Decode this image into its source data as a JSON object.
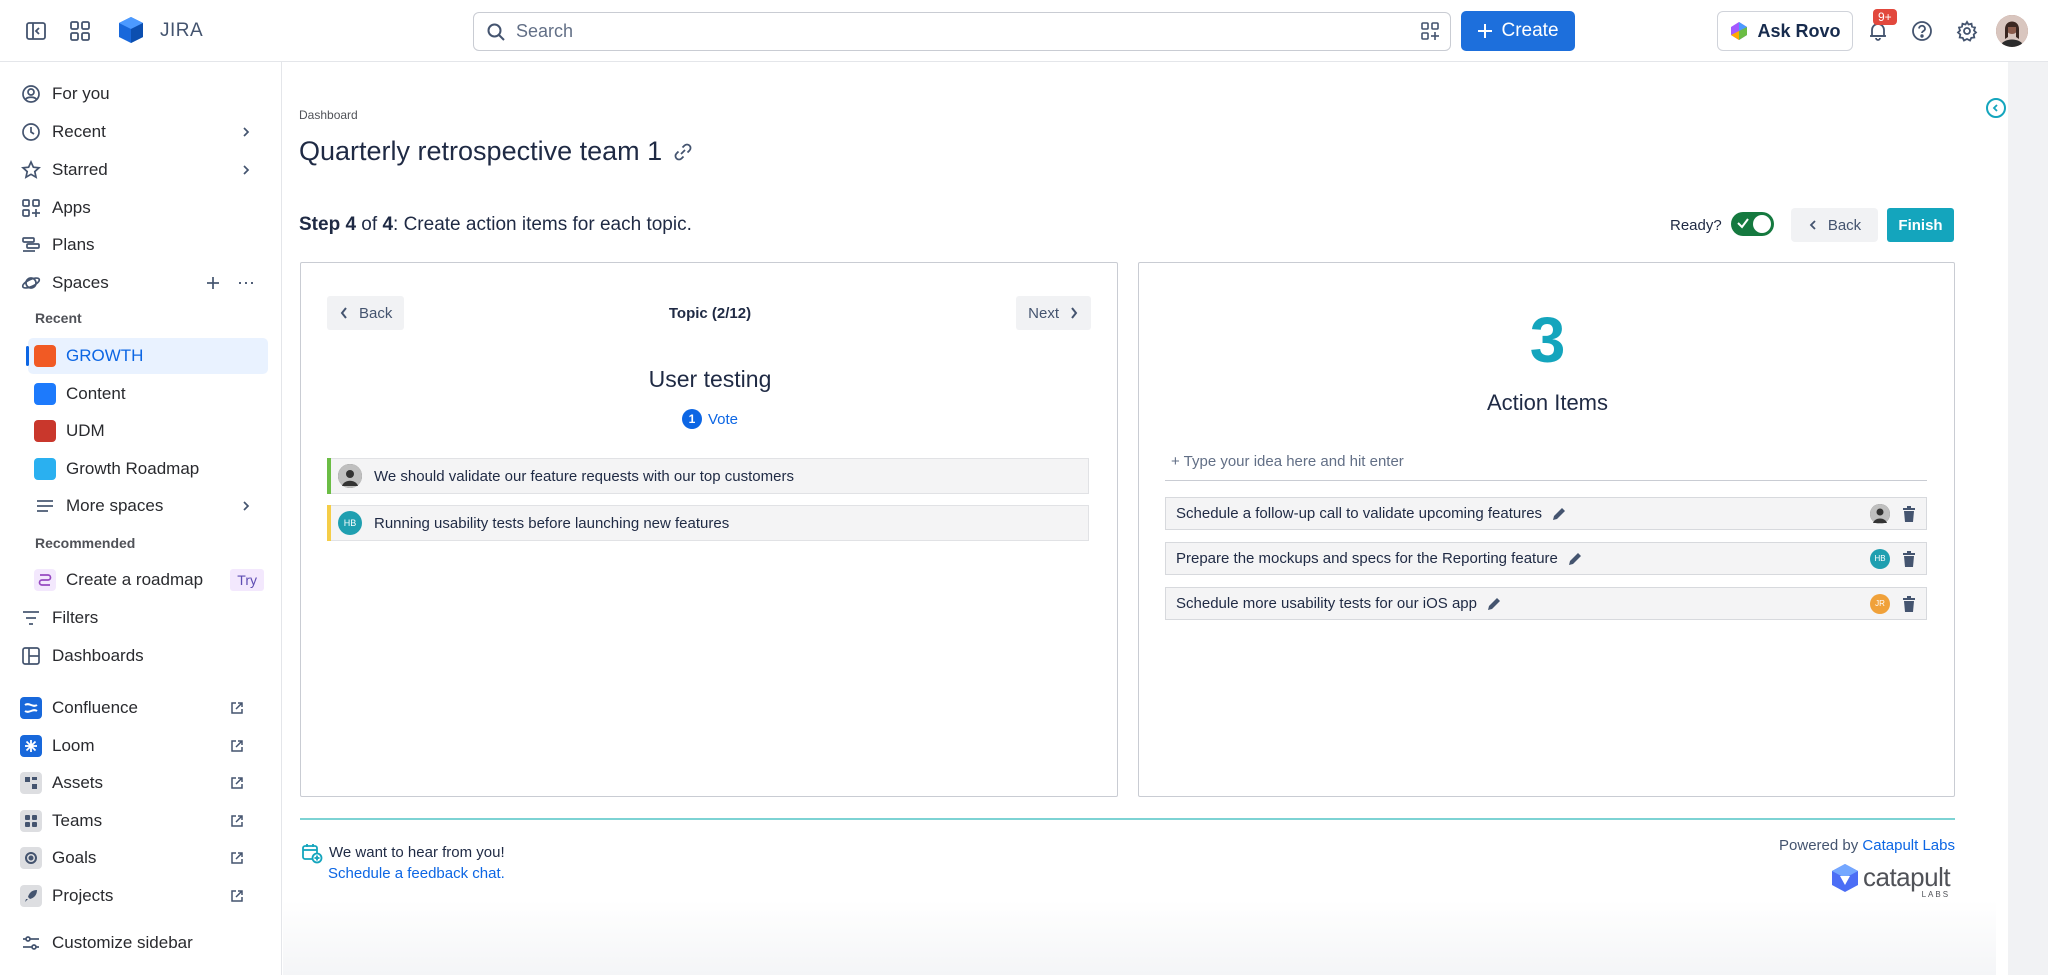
{
  "topbar": {
    "app_name": "JIRA",
    "search_placeholder": "Search",
    "create_label": "Create",
    "ask_rovo_label": "Ask Rovo",
    "notification_badge": "9+"
  },
  "sidebar": {
    "items": [
      {
        "label": "For you",
        "icon": "user-circle-icon"
      },
      {
        "label": "Recent",
        "icon": "clock-icon"
      },
      {
        "label": "Starred",
        "icon": "star-icon"
      },
      {
        "label": "Apps",
        "icon": "apps-icon"
      },
      {
        "label": "Plans",
        "icon": "plans-icon"
      },
      {
        "label": "Spaces",
        "icon": "planet-icon"
      }
    ],
    "recent_heading": "Recent",
    "spaces": [
      {
        "label": "GROWTH",
        "color": "#f15a24"
      },
      {
        "label": "Content",
        "color": "#1d7afc"
      },
      {
        "label": "UDM",
        "color": "#c9372c"
      },
      {
        "label": "Growth Roadmap",
        "color": "#2ab0f0"
      }
    ],
    "more_spaces": "More spaces",
    "recommended_heading": "Recommended",
    "create_roadmap": "Create a roadmap",
    "try_badge": "Try",
    "filters": "Filters",
    "dashboards": "Dashboards",
    "apps": [
      {
        "label": "Confluence",
        "color": "#1868db"
      },
      {
        "label": "Loom",
        "color": "#1868db"
      },
      {
        "label": "Assets",
        "color": "#dddee1"
      },
      {
        "label": "Teams",
        "color": "#dddee1"
      },
      {
        "label": "Goals",
        "color": "#dddee1"
      },
      {
        "label": "Projects",
        "color": "#dddee1"
      }
    ],
    "customize": "Customize sidebar"
  },
  "main": {
    "breadcrumb": "Dashboard",
    "title": "Quarterly retrospective team 1",
    "step_bold": "Step 4",
    "step_of": " of ",
    "step_total": "4",
    "step_desc": ": Create action items for each topic.",
    "ready_label": "Ready?",
    "back_label": "Back",
    "finish_label": "Finish",
    "topic": {
      "back_label": "Back",
      "next_label": "Next",
      "counter": "Topic (2/12)",
      "name": "User testing",
      "vote_count": "1",
      "vote_label": "Vote",
      "ideas": [
        {
          "text": "We should validate our feature requests with our top customers",
          "color": "#6bbd45"
        },
        {
          "text": "Running usability tests before launching new features",
          "color": "#f5cd47",
          "initials": "HB"
        }
      ]
    },
    "actions": {
      "count": "3",
      "label": "Action Items",
      "input_placeholder": "+ Type your idea here and hit enter",
      "items": [
        {
          "text": "Schedule a follow-up call to validate upcoming features"
        },
        {
          "text": "Prepare the mockups and specs for the Reporting feature",
          "initials": "HB"
        },
        {
          "text": "Schedule more usability tests for our iOS app",
          "initials": "JR"
        }
      ]
    },
    "footer": {
      "feedback_line1": "We want to hear from you!",
      "feedback_link": "Schedule a feedback chat",
      "feedback_end": ".",
      "powered_by": "Powered by ",
      "powered_link": "Catapult Labs",
      "brand_word": "catapult",
      "brand_sub": "LABS"
    }
  },
  "colors": {
    "accent": "#14a5bd",
    "primary": "#1d6fdc"
  }
}
